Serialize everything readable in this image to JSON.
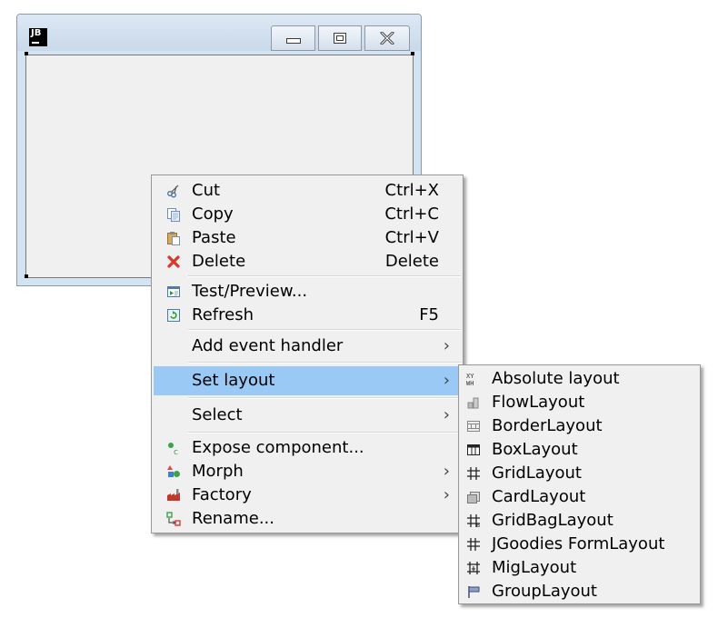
{
  "window": {
    "app_icon": "jb-logo-icon",
    "app_icon_text": "JB",
    "controls": {
      "minimize": "minimize-icon",
      "maximize": "maximize-icon",
      "close": "close-icon"
    }
  },
  "context_menu": {
    "items": [
      {
        "label": "Cut",
        "shortcut": "Ctrl+X",
        "icon": "scissors-icon"
      },
      {
        "label": "Copy",
        "shortcut": "Ctrl+C",
        "icon": "copy-icon"
      },
      {
        "label": "Paste",
        "shortcut": "Ctrl+V",
        "icon": "paste-icon"
      },
      {
        "label": "Delete",
        "shortcut": "Delete",
        "icon": "delete-icon"
      },
      {
        "label": "Test/Preview...",
        "shortcut": "",
        "icon": "preview-icon"
      },
      {
        "label": "Refresh",
        "shortcut": "F5",
        "icon": "refresh-icon"
      },
      {
        "label": "Add event handler",
        "submenu": true
      },
      {
        "label": "Set layout",
        "submenu": true,
        "highlighted": true
      },
      {
        "label": "Select",
        "submenu": true
      },
      {
        "label": "Expose component...",
        "icon": "expose-component-icon"
      },
      {
        "label": "Morph",
        "submenu": true,
        "icon": "morph-icon"
      },
      {
        "label": "Factory",
        "submenu": true,
        "icon": "factory-icon"
      },
      {
        "label": "Rename...",
        "icon": "rename-icon"
      }
    ]
  },
  "layout_submenu": {
    "items": [
      {
        "label": "Absolute layout",
        "icon": "absolute-layout-icon"
      },
      {
        "label": "FlowLayout",
        "icon": "flow-layout-icon"
      },
      {
        "label": "BorderLayout",
        "icon": "border-layout-icon"
      },
      {
        "label": "BoxLayout",
        "icon": "box-layout-icon"
      },
      {
        "label": "GridLayout",
        "icon": "grid-layout-icon"
      },
      {
        "label": "CardLayout",
        "icon": "card-layout-icon"
      },
      {
        "label": "GridBagLayout",
        "icon": "gridbag-layout-icon"
      },
      {
        "label": "JGoodies FormLayout",
        "icon": "form-layout-icon"
      },
      {
        "label": "MigLayout",
        "icon": "mig-layout-icon"
      },
      {
        "label": "GroupLayout",
        "icon": "group-layout-icon"
      }
    ]
  },
  "colors": {
    "highlight": "#99c9f4",
    "menu_bg": "#f0f0f0",
    "delete_red": "#d9372b"
  }
}
